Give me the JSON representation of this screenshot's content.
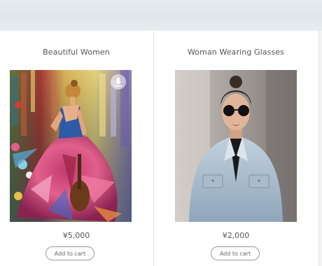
{
  "products": [
    {
      "title": "Beautiful Women",
      "price": "¥5,000",
      "button_label": "Add to cart",
      "image_icon": "painting-woman-dancer",
      "overlay_icon": "download-icon"
    },
    {
      "title": "Woman Wearing Glasses",
      "price": "¥2,000",
      "button_label": "Add to cart",
      "image_icon": "photo-woman-sunglasses"
    }
  ],
  "colors": {
    "header_band": "#e3e8ec",
    "divider": "#e2e2e2",
    "button_border": "#9a9a9a",
    "text": "#555555"
  }
}
